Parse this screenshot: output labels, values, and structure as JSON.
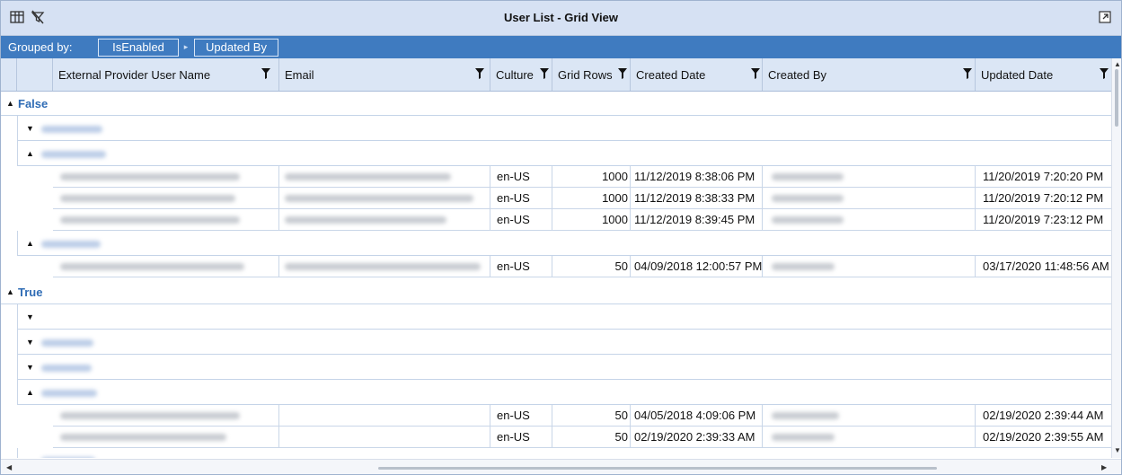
{
  "window": {
    "title": "User List - Grid View",
    "icons": [
      "column-chooser-icon",
      "clear-filter-icon",
      "pop-out-icon"
    ]
  },
  "group_bar": {
    "label": "Grouped by:",
    "chips": [
      "IsEnabled",
      "Updated By"
    ]
  },
  "columns": [
    {
      "label": "External Provider User Name",
      "filter": true
    },
    {
      "label": "Email",
      "filter": true
    },
    {
      "label": "Culture",
      "filter": true
    },
    {
      "label": "Grid Rows",
      "filter": true
    },
    {
      "label": "Created Date",
      "filter": true
    },
    {
      "label": "Created By",
      "filter": true
    },
    {
      "label": "Updated Date",
      "filter": true
    }
  ],
  "groups": {
    "false_label": "False",
    "true_label": "True"
  },
  "rows": {
    "r1": {
      "culture": "en-US",
      "grid_rows": "1000",
      "created_date": "11/12/2019 8:38:06 PM",
      "updated_date": "11/20/2019 7:20:20 PM"
    },
    "r2": {
      "culture": "en-US",
      "grid_rows": "1000",
      "created_date": "11/12/2019 8:38:33 PM",
      "updated_date": "11/20/2019 7:20:12 PM"
    },
    "r3": {
      "culture": "en-US",
      "grid_rows": "1000",
      "created_date": "11/12/2019 8:39:45 PM",
      "updated_date": "11/20/2019 7:23:12 PM"
    },
    "r4": {
      "culture": "en-US",
      "grid_rows": "50",
      "created_date": "04/09/2018 12:00:57 PM",
      "updated_date": "03/17/2020 11:48:56 AM"
    },
    "r5": {
      "culture": "en-US",
      "grid_rows": "50",
      "created_date": "04/05/2018 4:09:06 PM",
      "updated_date": "02/19/2020 2:39:44 AM"
    },
    "r6": {
      "culture": "en-US",
      "grid_rows": "50",
      "created_date": "02/19/2020 2:39:33 AM",
      "updated_date": "02/19/2020 2:39:55 AM"
    }
  },
  "colors": {
    "title_bar": "#d6e1f3",
    "group_bar": "#3f7bc0",
    "header": "#dbe6f5",
    "group_text": "#2f6cb5"
  }
}
